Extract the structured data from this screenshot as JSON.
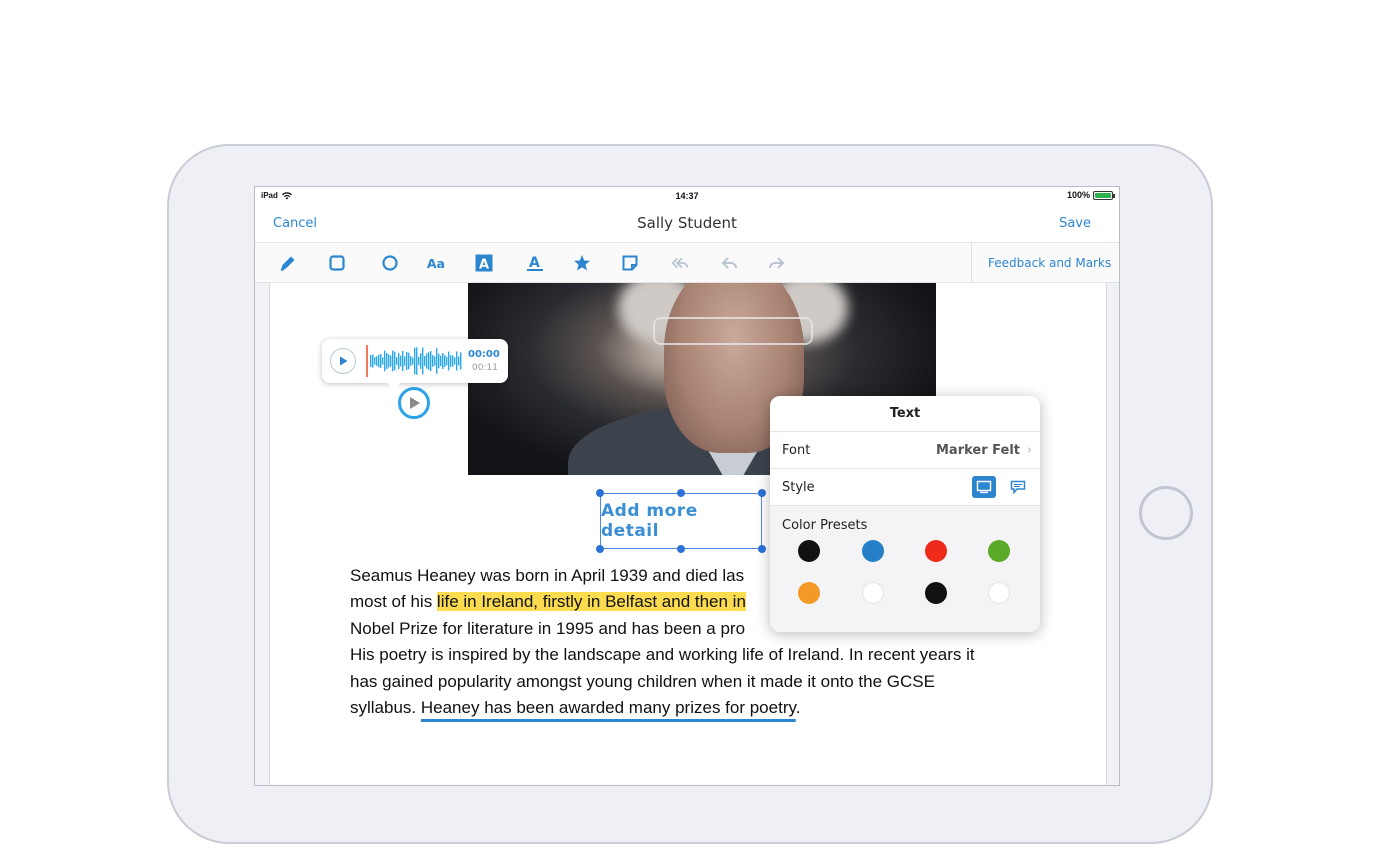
{
  "status_bar": {
    "device": "iPad",
    "time": "14:37",
    "battery": "100%",
    "battery_level": 1.0
  },
  "nav": {
    "cancel": "Cancel",
    "title": "Sally Student",
    "save": "Save"
  },
  "toolbar": {
    "tools": [
      {
        "name": "pen-tool-icon"
      },
      {
        "name": "rectangle-tool-icon"
      },
      {
        "name": "circle-tool-icon"
      },
      {
        "name": "text-tool-icon"
      },
      {
        "name": "text-box-tool-icon"
      },
      {
        "name": "highlight-text-tool-icon"
      },
      {
        "name": "stamp-tool-icon"
      },
      {
        "name": "note-tool-icon"
      },
      {
        "name": "undo-all-icon"
      },
      {
        "name": "undo-icon"
      },
      {
        "name": "redo-icon"
      }
    ],
    "feedback": "Feedback and Marks"
  },
  "audio": {
    "elapsed": "00:00",
    "duration": "00:11"
  },
  "annotation": {
    "text": "Add more detail"
  },
  "body": {
    "line1": "Seamus Heaney was born in April 1939 and died las",
    "line2_pre": "most of his ",
    "line2_highlight": "life in Ireland, firstly in Belfast and then in",
    "line3": "Nobel Prize for literature in 1995 and has been a pro",
    "line4": "His poetry is inspired by the landscape and working life of Ireland. In recent years it",
    "line5": "has gained popularity amongst young children when it made it onto the GCSE",
    "line6_pre": "syllabus. ",
    "line6_underline": "Heaney has been awarded many prizes for poetry",
    "line6_post": "."
  },
  "popover": {
    "title": "Text",
    "font_label": "Font",
    "font_value": "Marker Felt",
    "style_label": "Style",
    "presets_label": "Color Presets",
    "swatches": [
      "#111111",
      "#2680c8",
      "#ee2a1b",
      "#5aa928",
      "#f29a25",
      "#ffffff",
      "#111111",
      "#ffffff"
    ]
  },
  "colors": {
    "accent": "#2c86cf",
    "highlight": "#fbdc4f"
  }
}
